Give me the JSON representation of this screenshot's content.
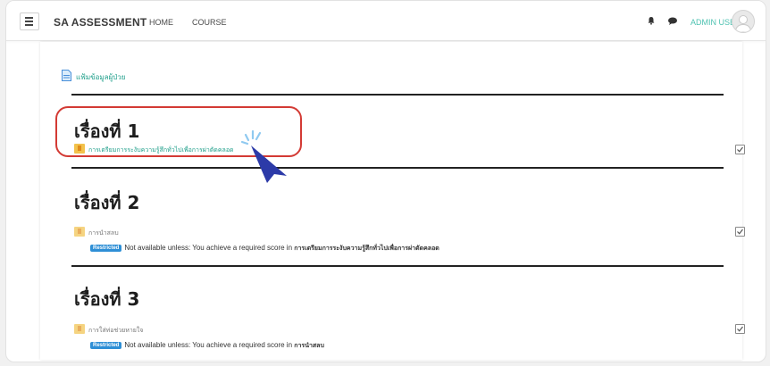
{
  "header": {
    "brand": "SA ASSESSMENT",
    "nav": [
      "HOME",
      "COURSE"
    ],
    "user_name": "ADMIN USER"
  },
  "icons": {
    "menu": "hamburger-icon",
    "notifications": "bell-icon",
    "messages": "chat-icon",
    "avatar": "user-avatar-icon",
    "file": "file-icon",
    "activity": "quiz-icon",
    "completion": "checkbox-icon",
    "cursor": "pointer-icon"
  },
  "colors": {
    "accent": "#4ec2b1",
    "link": "#1f9f8a",
    "restricted_badge": "#2e8fd6",
    "highlight": "#d33a34",
    "cursor": "#2c3aa8"
  },
  "file_link": {
    "label": "แฟ้มข้อมูลผู้ป่วย"
  },
  "sections": [
    {
      "title": "เรื่องที่ 1",
      "activity": "การเตรียมการระงับความรู้สึกทั่วไปเพื่อการผ่าตัดคลอด",
      "restricted": false
    },
    {
      "title": "เรื่องที่ 2",
      "activity": "การนำสลบ",
      "restricted": true,
      "badge": "Restricted",
      "restriction_text": "Not available unless: You achieve a required score in",
      "restriction_target": "การเตรียมการระงับความรู้สึกทั่วไปเพื่อการผ่าตัดคลอด"
    },
    {
      "title": "เรื่องที่ 3",
      "activity": "การใส่ท่อช่วยหายใจ",
      "restricted": true,
      "badge": "Restricted",
      "restriction_text": "Not available unless: You achieve a required score in",
      "restriction_target": "การนำสลบ"
    }
  ]
}
